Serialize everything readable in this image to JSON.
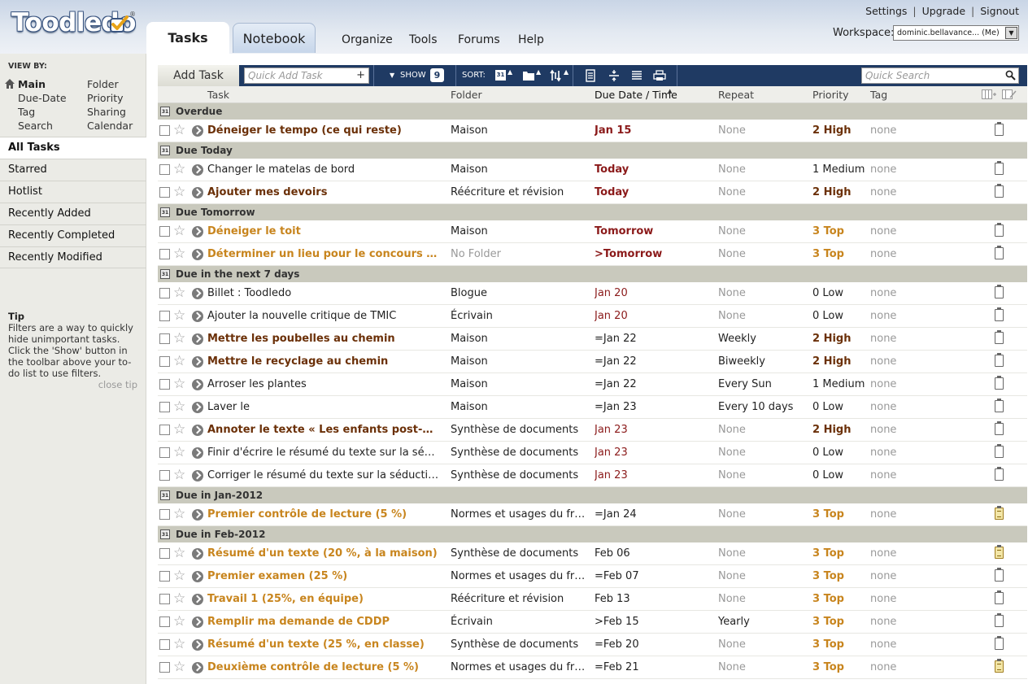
{
  "app": {
    "logo_text": "Toodledo",
    "logo_mark": "®"
  },
  "header": {
    "tabs": [
      {
        "label": "Tasks",
        "active": true
      },
      {
        "label": "Notebook",
        "active": false
      }
    ],
    "nav": [
      "Organize",
      "Tools",
      "Forums",
      "Help"
    ],
    "top_links": [
      "Settings",
      "Upgrade",
      "Signout"
    ],
    "top_links_separator": "|",
    "workspace_label": "Workspace:",
    "workspace_value": "dominic.bellavance... (Me)"
  },
  "sidebar": {
    "viewby_label": "VIEW BY:",
    "viewby_left": [
      "Main",
      "Due-Date",
      "Tag",
      "Search"
    ],
    "viewby_right": [
      "Folder",
      "Priority",
      "Sharing",
      "Calendar"
    ],
    "items": [
      "All Tasks",
      "Starred",
      "Hotlist",
      "Recently Added",
      "Recently Completed",
      "Recently Modified"
    ],
    "active_item": "All Tasks",
    "tip_title": "Tip",
    "tip_text": "Filters are a way to quickly hide unimportant tasks. Click the 'Show' button in the toolbar above your to-do list to use filters.",
    "close_tip": "close tip"
  },
  "toolbar": {
    "add_task": "Add Task",
    "quick_add_placeholder": "Quick Add Task",
    "quick_add_plus": "+",
    "show_label": "SHOW",
    "show_count": "9",
    "sort_label": "SORT:",
    "sort_date_icon_text": "31",
    "quick_search_placeholder": "Quick Search"
  },
  "columns": {
    "task": "Task",
    "folder": "Folder",
    "due": "Due Date / Time",
    "repeat": "Repeat",
    "priority": "Priority",
    "tag": "Tag"
  },
  "colors": {
    "toolbar_bg": "#1f3a63",
    "group_bg": "#c9c9bd",
    "high_priority": "#6b3008",
    "top_priority": "#c8851e",
    "due_red": "#8b1a1a"
  },
  "groups": [
    {
      "label": "Overdue",
      "rows": [
        {
          "task": "Déneiger le tempo (ce qui reste)",
          "folder": "Maison",
          "due": "Jan 15",
          "repeat": "None",
          "priority": "2 High",
          "tag": "none",
          "note": false
        }
      ]
    },
    {
      "label": "Due Today",
      "rows": [
        {
          "task": "Changer le matelas de bord",
          "folder": "Maison",
          "due": "Today",
          "repeat": "None",
          "priority": "1 Medium",
          "tag": "none",
          "note": false
        },
        {
          "task": "Ajouter mes devoirs",
          "folder": "Réécriture et révision",
          "due": "Today",
          "repeat": "None",
          "priority": "2 High",
          "tag": "none",
          "note": false
        }
      ]
    },
    {
      "label": "Due Tomorrow",
      "rows": [
        {
          "task": "Déneiger le toit",
          "folder": "Maison",
          "due": "Tomorrow",
          "repeat": "None",
          "priority": "3 Top",
          "tag": "none",
          "note": false
        },
        {
          "task": "Déterminer un lieu pour le concours du go...",
          "folder": "No Folder",
          "due": ">Tomorrow",
          "repeat": "None",
          "priority": "3 Top",
          "tag": "none",
          "note": false
        }
      ]
    },
    {
      "label": "Due in the next 7 days",
      "rows": [
        {
          "task": "Billet : Toodledo",
          "folder": "Blogue",
          "due": "Jan 20",
          "repeat": "None",
          "priority": "0 Low",
          "tag": "none",
          "note": false
        },
        {
          "task": "Ajouter la nouvelle critique de TMIC",
          "folder": "Écrivain",
          "due": "Jan 20",
          "repeat": "None",
          "priority": "0 Low",
          "tag": "none",
          "note": false
        },
        {
          "task": "Mettre les poubelles au chemin",
          "folder": "Maison",
          "due": "=Jan 22",
          "repeat": "Weekly",
          "priority": "2 High",
          "tag": "none",
          "note": false
        },
        {
          "task": "Mettre le recyclage au chemin",
          "folder": "Maison",
          "due": "=Jan 22",
          "repeat": "Biweekly",
          "priority": "2 High",
          "tag": "none",
          "note": false
        },
        {
          "task": "Arroser les plantes",
          "folder": "Maison",
          "due": "=Jan 22",
          "repeat": "Every Sun",
          "priority": "1 Medium",
          "tag": "none",
          "note": false
        },
        {
          "task": "Laver le",
          "folder": "Maison",
          "due": "=Jan 23",
          "repeat": "Every 10 days",
          "priority": "0 Low",
          "tag": "none",
          "note": false
        },
        {
          "task": "Annoter le texte « Les enfants post-modern...",
          "folder": "Synthèse de documents",
          "due": "Jan 23",
          "repeat": "None",
          "priority": "2 High",
          "tag": "none",
          "note": false
        },
        {
          "task": "Finir d'écrire le résumé du texte sur la séduction",
          "folder": "Synthèse de documents",
          "due": "Jan 23",
          "repeat": "None",
          "priority": "0 Low",
          "tag": "none",
          "note": false
        },
        {
          "task": "Corriger le résumé du texte sur la séduction",
          "folder": "Synthèse de documents",
          "due": "Jan 23",
          "repeat": "None",
          "priority": "0 Low",
          "tag": "none",
          "note": false
        }
      ]
    },
    {
      "label": "Due in Jan-2012",
      "rows": [
        {
          "task": "Premier contrôle de lecture (5 %)",
          "folder": "Normes et usages du fran...",
          "due": "=Jan 24",
          "repeat": "None",
          "priority": "3 Top",
          "tag": "none",
          "note": true
        }
      ]
    },
    {
      "label": "Due in Feb-2012",
      "rows": [
        {
          "task": "Résumé d'un texte (20 %, à la maison)",
          "folder": "Synthèse de documents",
          "due": "Feb 06",
          "repeat": "None",
          "priority": "3 Top",
          "tag": "none",
          "note": true
        },
        {
          "task": "Premier examen (25 %)",
          "folder": "Normes et usages du fran...",
          "due": "=Feb 07",
          "repeat": "None",
          "priority": "3 Top",
          "tag": "none",
          "note": false
        },
        {
          "task": "Travail 1 (25%, en équipe)",
          "folder": "Réécriture et révision",
          "due": "Feb 13",
          "repeat": "None",
          "priority": "3 Top",
          "tag": "none",
          "note": false
        },
        {
          "task": "Remplir ma demande de CDDP",
          "folder": "Écrivain",
          "due": ">Feb 15",
          "repeat": "Yearly",
          "priority": "3 Top",
          "tag": "none",
          "note": false
        },
        {
          "task": "Résumé d'un texte (25 %, en classe)",
          "folder": "Synthèse de documents",
          "due": "=Feb 20",
          "repeat": "None",
          "priority": "3 Top",
          "tag": "none",
          "note": false
        },
        {
          "task": "Deuxième contrôle de lecture (5 %)",
          "folder": "Normes et usages du fran...",
          "due": "=Feb 21",
          "repeat": "None",
          "priority": "3 Top",
          "tag": "none",
          "note": true
        }
      ]
    }
  ]
}
